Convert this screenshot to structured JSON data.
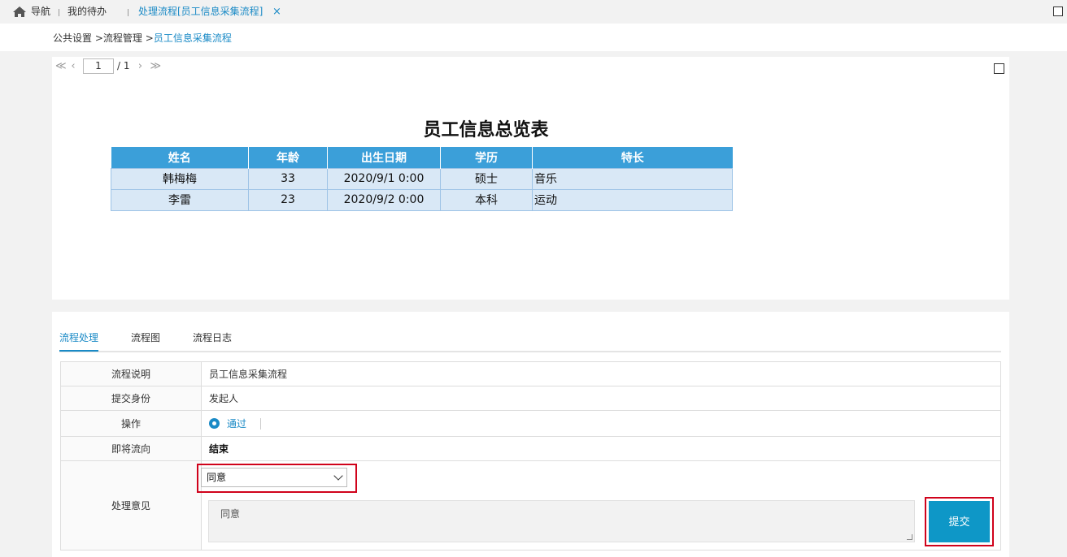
{
  "topbar": {
    "nav_label": "导航",
    "todo_label": "我的待办",
    "active_tab_label": "处理流程[员工信息采集流程]",
    "close_glyph": "×"
  },
  "breadcrumb": {
    "items": [
      "公共设置",
      "流程管理",
      "员工信息采集流程"
    ],
    "separator": ">"
  },
  "pager": {
    "first": "≪",
    "prev": "‹",
    "current_page": "1",
    "total": "/ 1",
    "next": "›",
    "last": "≫"
  },
  "report": {
    "title": "员工信息总览表",
    "columns": [
      "姓名",
      "年龄",
      "出生日期",
      "学历",
      "特长"
    ],
    "rows": [
      [
        "韩梅梅",
        "33",
        "2020/9/1 0:00",
        "硕士",
        "音乐"
      ],
      [
        "李雷",
        "23",
        "2020/9/2 0:00",
        "本科",
        "运动"
      ]
    ]
  },
  "tabs": [
    "流程处理",
    "流程图",
    "流程日志"
  ],
  "form": {
    "desc_label": "流程说明",
    "desc_value": "员工信息采集流程",
    "identity_label": "提交身份",
    "identity_value": "发起人",
    "action_label": "操作",
    "action_value": "通过",
    "next_label": "即将流向",
    "next_value": "结束",
    "opinion_label": "处理意见",
    "opinion_select": "同意",
    "opinion_text": "同意",
    "submit_label": "提交"
  },
  "colors": {
    "accent": "#1a8ac6",
    "table_header": "#3b9fd9",
    "table_row": "#d9e8f6",
    "highlight": "#d0021b",
    "submit": "#0e97c7"
  }
}
